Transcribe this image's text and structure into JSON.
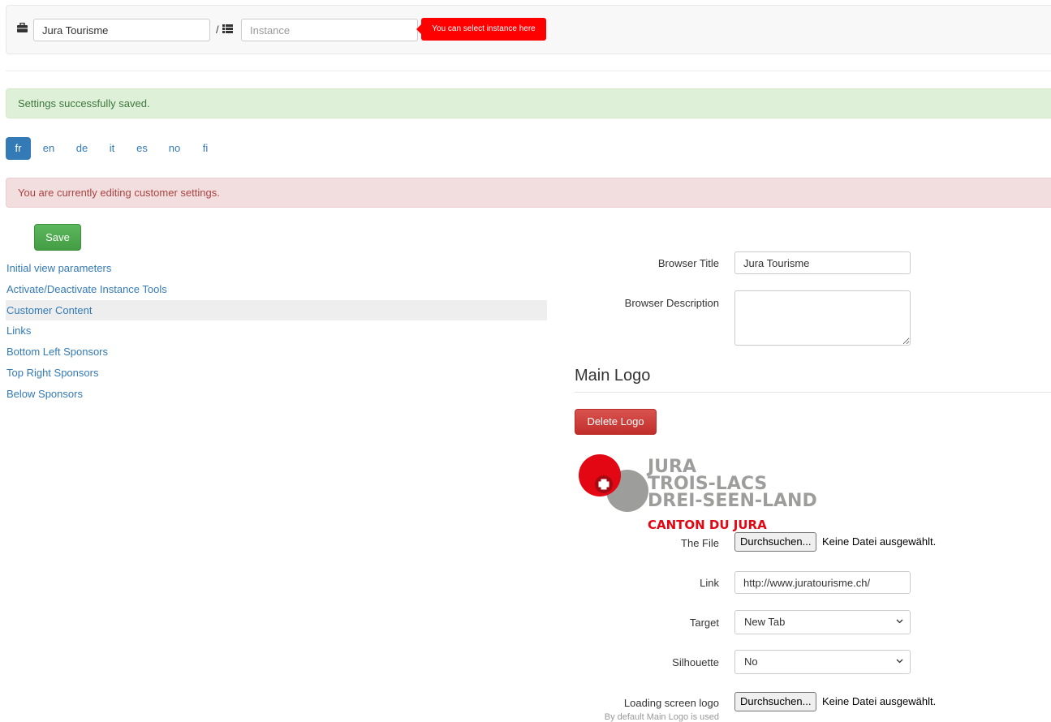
{
  "topbar": {
    "customer_value": "Jura Tourisme",
    "separator": "/",
    "instance_placeholder": "Instance",
    "tooltip": "You can select instance here"
  },
  "alerts": {
    "success": "Settings successfully saved.",
    "editing": "You are currently editing customer settings."
  },
  "languages": {
    "items": [
      "fr",
      "en",
      "de",
      "it",
      "es",
      "no",
      "fi"
    ],
    "active": "fr"
  },
  "actions": {
    "save": "Save",
    "delete_logo": "Delete Logo"
  },
  "sidebar": {
    "items": [
      "Initial view parameters",
      "Activate/Deactivate Instance Tools",
      "Customer Content",
      "Links",
      "Bottom Left Sponsors",
      "Top Right Sponsors",
      "Below Sponsors"
    ],
    "active": "Customer Content"
  },
  "form": {
    "browser_title_label": "Browser Title",
    "browser_title_value": "Jura Tourisme",
    "browser_description_label": "Browser Description",
    "browser_description_value": "",
    "main_logo_heading": "Main Logo",
    "file_label": "The File",
    "file_button": "Durchsuchen...",
    "file_status": "Keine Datei ausgewählt.",
    "link_label": "Link",
    "link_value": "http://www.juratourisme.ch/",
    "target_label": "Target",
    "target_value": "New Tab",
    "silhouette_label": "Silhouette",
    "silhouette_value": "No",
    "loading_logo_label": "Loading screen logo",
    "loading_logo_button": "Durchsuchen...",
    "loading_logo_status": "Keine Datei ausgewählt.",
    "loading_logo_help": "By default Main Logo is used"
  },
  "logo": {
    "lines": [
      "JURA",
      "TROIS-LACS",
      "DREI-SEEN-LAND"
    ],
    "canton": "CANTON DU JURA"
  },
  "colors": {
    "link": "#337ab7",
    "success_bg": "#dff0d8",
    "danger_bg": "#f2dede",
    "tooltip": "#ff0000",
    "logo_red": "#e30613",
    "logo_grey": "#9d9d9c"
  },
  "icons": {
    "customer": "briefcase-icon",
    "instance": "list-icon",
    "select": "chevron-down-icon"
  }
}
